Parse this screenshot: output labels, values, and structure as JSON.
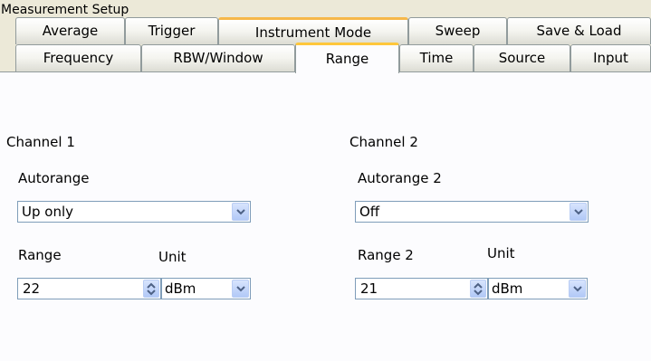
{
  "window": {
    "title": "Measurement Setup"
  },
  "tabs_row1": [
    "Average",
    "Trigger",
    "Instrument Mode",
    "Sweep",
    "Save & Load"
  ],
  "tabs_row2": [
    "Frequency",
    "RBW/Window",
    "Range",
    "Time",
    "Source",
    "Input"
  ],
  "active_tab": "Range",
  "channel1": {
    "heading": "Channel 1",
    "autorange_label": "Autorange",
    "autorange_value": "Up only",
    "range_label": "Range",
    "range_value": "22",
    "unit_label": "Unit",
    "unit_value": "dBm"
  },
  "channel2": {
    "heading": "Channel 2",
    "autorange_label": "Autorange 2",
    "autorange_value": "Off",
    "range_label": "Range 2",
    "range_value": "21",
    "unit_label": "Unit",
    "unit_value": "dBm"
  },
  "icons": {
    "dropdown": "chevron-down-icon",
    "spinner": "spinner-arrows-icon"
  }
}
